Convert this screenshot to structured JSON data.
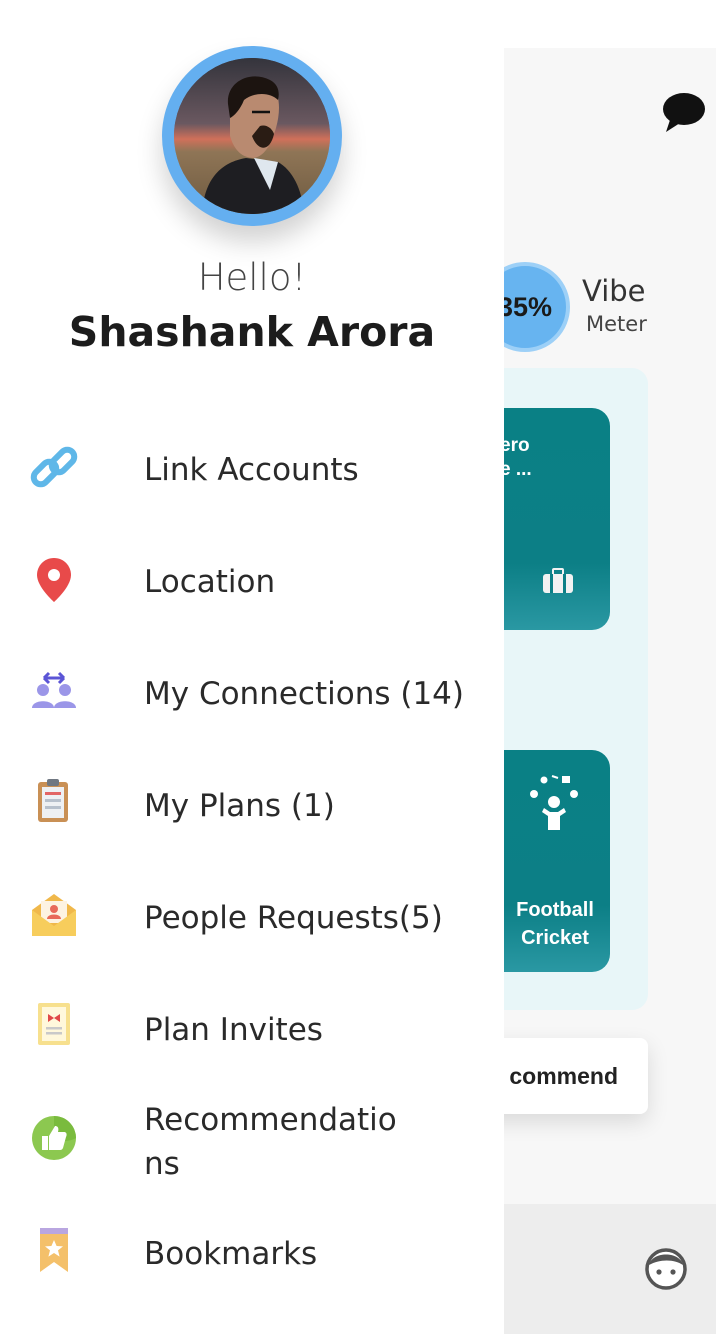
{
  "drawer": {
    "greeting": "Hello!",
    "user_name": "Shashank Arora",
    "menu": [
      {
        "label": "Link Accounts",
        "icon": "link-icon"
      },
      {
        "label": "Location",
        "icon": "location-pin-icon"
      },
      {
        "label": "My Connections (14)",
        "icon": "connections-icon"
      },
      {
        "label": "My Plans (1)",
        "icon": "clipboard-icon"
      },
      {
        "label": "People Requests(5)",
        "icon": "envelope-person-icon"
      },
      {
        "label": "Plan Invites",
        "icon": "invite-card-icon"
      },
      {
        "label": "Recommendatio\nns",
        "icon": "thumbs-up-icon"
      },
      {
        "label": "Bookmarks",
        "icon": "bookmark-icon"
      }
    ]
  },
  "background": {
    "vibe_percent": "35%",
    "vibe_title": "Vibe",
    "vibe_subtitle": "Meter",
    "card_1_text": "ero\ne ...",
    "card_2_text": "Football\nCricket",
    "recommend_label": "commend"
  },
  "colors": {
    "accent_blue": "#64aff0",
    "teal": "#0a8085"
  }
}
